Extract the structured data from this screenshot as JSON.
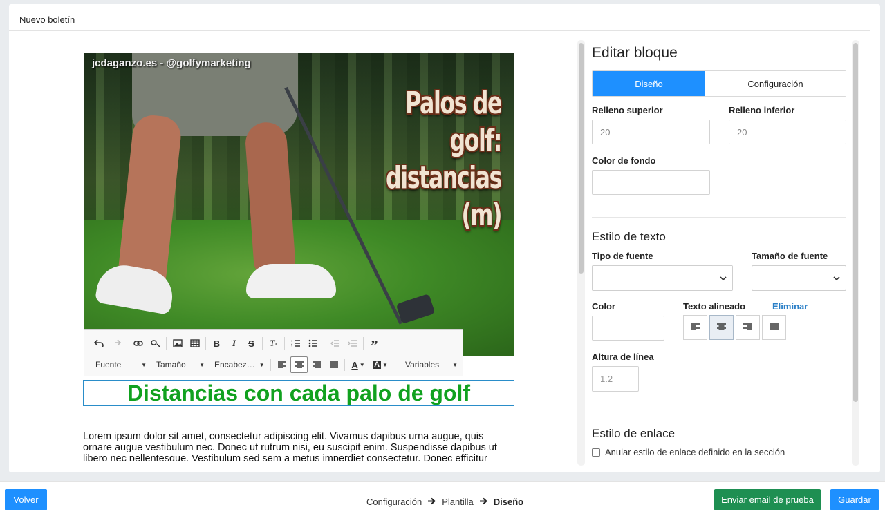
{
  "card": {
    "title": "Nuevo boletín"
  },
  "hero": {
    "credit": "jcdaganzo.es - @golfymarketing",
    "headline_line1": "Palos de golf:",
    "headline_line2": "distancias (m)"
  },
  "editor_toolbar": {
    "font_label": "Fuente",
    "size_label": "Tamaño",
    "heading_label": "Encabez…",
    "variables_label": "Variables",
    "icons": [
      "undo-icon",
      "redo-icon",
      "link-icon",
      "unlink-icon",
      "image-icon",
      "table-icon",
      "bold-icon",
      "italic-icon",
      "strikethrough-icon",
      "clear-format-icon",
      "numbered-list-icon",
      "bulleted-list-icon",
      "outdent-icon",
      "indent-icon",
      "blockquote-icon"
    ]
  },
  "content": {
    "title": "Distancias con cada palo de golf",
    "body": "Lorem ipsum dolor sit amet, consectetur adipiscing elit. Vivamus dapibus urna augue, quis ornare augue vestibulum nec. Donec ut rutrum nisi, eu suscipit enim. Suspendisse dapibus ut libero nec pellentesque. Vestibulum sed sem a metus imperdiet consectetur. Donec efficitur"
  },
  "panel": {
    "title": "Editar bloque",
    "tabs": [
      {
        "label": "Diseño",
        "active": true
      },
      {
        "label": "Configuración",
        "active": false
      }
    ],
    "padding_top_label": "Relleno superior",
    "padding_top_value": "20",
    "padding_bottom_label": "Relleno inferior",
    "padding_bottom_value": "20",
    "unit": "px",
    "bg_color_label": "Color de fondo",
    "text_style_title": "Estilo de texto",
    "font_type_label": "Tipo de fuente",
    "font_size_label": "Tamaño de fuente",
    "color_label": "Color",
    "text_align_label": "Texto alineado",
    "remove_link": "Eliminar",
    "line_height_label": "Altura de línea",
    "line_height_value": "1.2",
    "link_style_title": "Estilo de enlace",
    "override_link_label": "Anular estilo de enlace definido en la sección",
    "accent_color": "#1e90ff"
  },
  "footer": {
    "back_label": "Volver",
    "breadcrumb": [
      "Configuración",
      "Plantilla",
      "Diseño"
    ],
    "test_email_label": "Enviar email de prueba",
    "save_label": "Guardar",
    "save_color": "#1e90ff",
    "test_color": "#1e8f52"
  }
}
